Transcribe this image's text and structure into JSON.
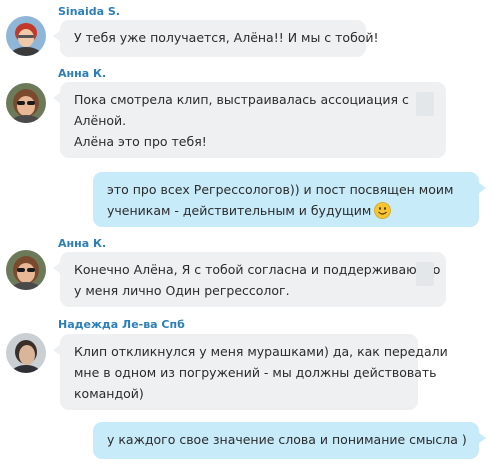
{
  "chat": {
    "messages": [
      {
        "sender": "Sinaida S.",
        "lines": [
          "У тебя уже получается, Алёна!! И мы с тобой!"
        ]
      },
      {
        "sender": "Анна К.",
        "lines": [
          "Пока смотрела клип, выстраивалась ассоциация с",
          "Алёной.",
          "Алёна это про тебя!"
        ]
      },
      {
        "sender": "",
        "lines": [
          "это про всех Регрессологов)) и пост посвящен моим",
          "ученикам - действительным и будущим"
        ],
        "emoji": "smiley-icon"
      },
      {
        "sender": "Анна К.",
        "lines": [
          "Конечно Алёна, Я с тобой согласна и поддерживаю, но",
          "у меня лично Один регрессолог."
        ]
      },
      {
        "sender": "Надежда Ле-ва Спб",
        "lines": [
          "Клип откликнулся у меня мурашками) да, как передали",
          "мне в одном из погружений - мы должны действовать",
          "командой)"
        ]
      },
      {
        "sender": "",
        "lines": [
          "у каждого свое значение слова и понимание смысла )"
        ]
      }
    ]
  },
  "colors": {
    "sender_name": "#2c7fb8",
    "incoming_bubble": "#eef0f2",
    "outgoing_bubble": "#c8ebfa"
  }
}
